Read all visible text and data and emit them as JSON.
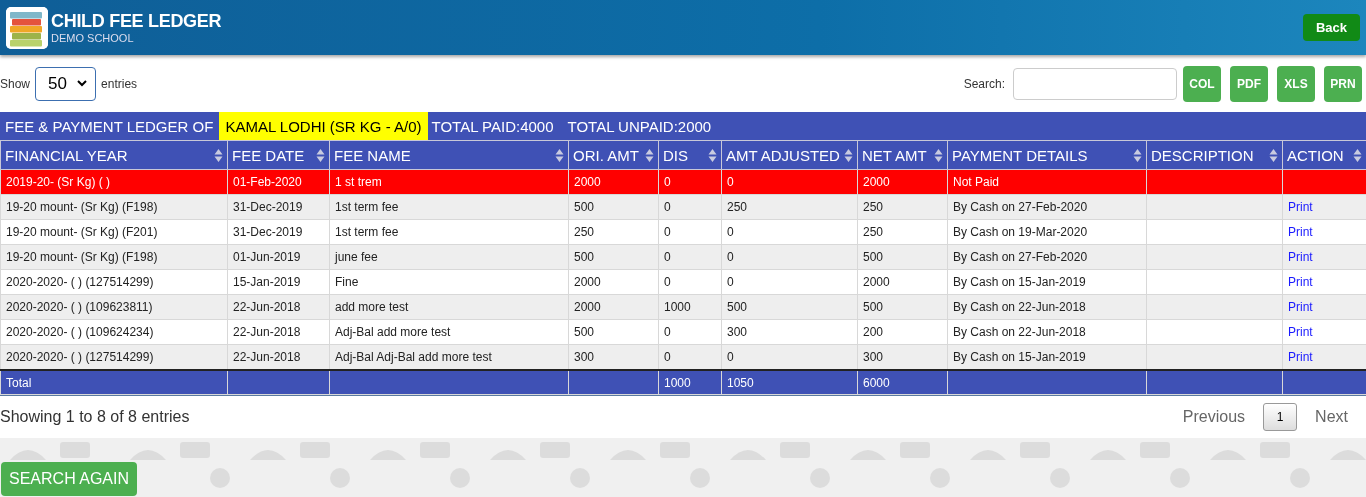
{
  "app": {
    "title": "CHILD FEE LEDGER",
    "subtitle": "DEMO SCHOOL",
    "back_button": "Back"
  },
  "controls": {
    "show_label": "Show",
    "page_size": "50",
    "entries_label": "entries",
    "search_label": "Search:",
    "export_buttons": [
      "COL",
      "PDF",
      "XLS",
      "PRN"
    ]
  },
  "ledger": {
    "title": "FEE & PAYMENT LEDGER OF",
    "student": "KAMAL LODHI (SR KG - A/0)",
    "total_paid": "TOTAL PAID:4000",
    "total_unpaid": "TOTAL UNPAID:2000"
  },
  "table": {
    "columns": [
      "FINANCIAL YEAR",
      "FEE DATE",
      "FEE NAME",
      "ORI. AMT",
      "DIS",
      "AMT ADJUSTED",
      "NET AMT",
      "PAYMENT DETAILS",
      "DESCRIPTION",
      "ACTION"
    ],
    "rows": [
      {
        "unpaid": true,
        "cells": [
          "2019-20- (Sr Kg) ( )",
          "01-Feb-2020",
          "1 st trem",
          "2000",
          "0",
          "0",
          "2000",
          "Not Paid",
          null
        ]
      },
      {
        "unpaid": false,
        "cells": [
          "19-20 mount- (Sr Kg) (F198)",
          "31-Dec-2019",
          "1st term fee",
          "500",
          "0",
          "250",
          "250",
          "By Cash on 27-Feb-2020",
          null
        ],
        "action": "Print"
      },
      {
        "unpaid": false,
        "cells": [
          "19-20 mount- (Sr Kg) (F201)",
          "31-Dec-2019",
          "1st term fee",
          "250",
          "0",
          "0",
          "250",
          "By Cash on 19-Mar-2020",
          null
        ],
        "action": "Print"
      },
      {
        "unpaid": false,
        "cells": [
          "19-20 mount- (Sr Kg) (F198)",
          "01-Jun-2019",
          "june fee",
          "500",
          "0",
          "0",
          "500",
          "By Cash on 27-Feb-2020",
          null
        ],
        "action": "Print"
      },
      {
        "unpaid": false,
        "cells": [
          "2020-2020- ( ) (127514299)",
          "15-Jan-2019",
          "Fine",
          "2000",
          "0",
          "0",
          "2000",
          "By Cash on 15-Jan-2019",
          null
        ],
        "action": "Print"
      },
      {
        "unpaid": false,
        "cells": [
          "2020-2020- ( ) (109623811)",
          "22-Jun-2018",
          "add more test",
          "2000",
          "1000",
          "500",
          "500",
          "By Cash on 22-Jun-2018",
          null
        ],
        "action": "Print"
      },
      {
        "unpaid": false,
        "cells": [
          "2020-2020- ( ) (109624234)",
          "22-Jun-2018",
          "Adj-Bal add more test",
          "500",
          "0",
          "300",
          "200",
          "By Cash on 22-Jun-2018",
          null
        ],
        "action": "Print"
      },
      {
        "unpaid": false,
        "cells": [
          "2020-2020- ( ) (127514299)",
          "22-Jun-2018",
          "Adj-Bal Adj-Bal add more test",
          "300",
          "0",
          "0",
          "300",
          "By Cash on 15-Jan-2019",
          null
        ],
        "action": "Print"
      }
    ],
    "totals": {
      "label": "Total",
      "dis": "1000",
      "amt_adjusted": "1050",
      "net_amt": "6000"
    }
  },
  "footer": {
    "info": "Showing 1 to 8 of 8 entries",
    "previous": "Previous",
    "pages": [
      {
        "label": "1",
        "selected": true
      }
    ],
    "next": "Next"
  },
  "search_again_button": "SEARCH AGAIN"
}
